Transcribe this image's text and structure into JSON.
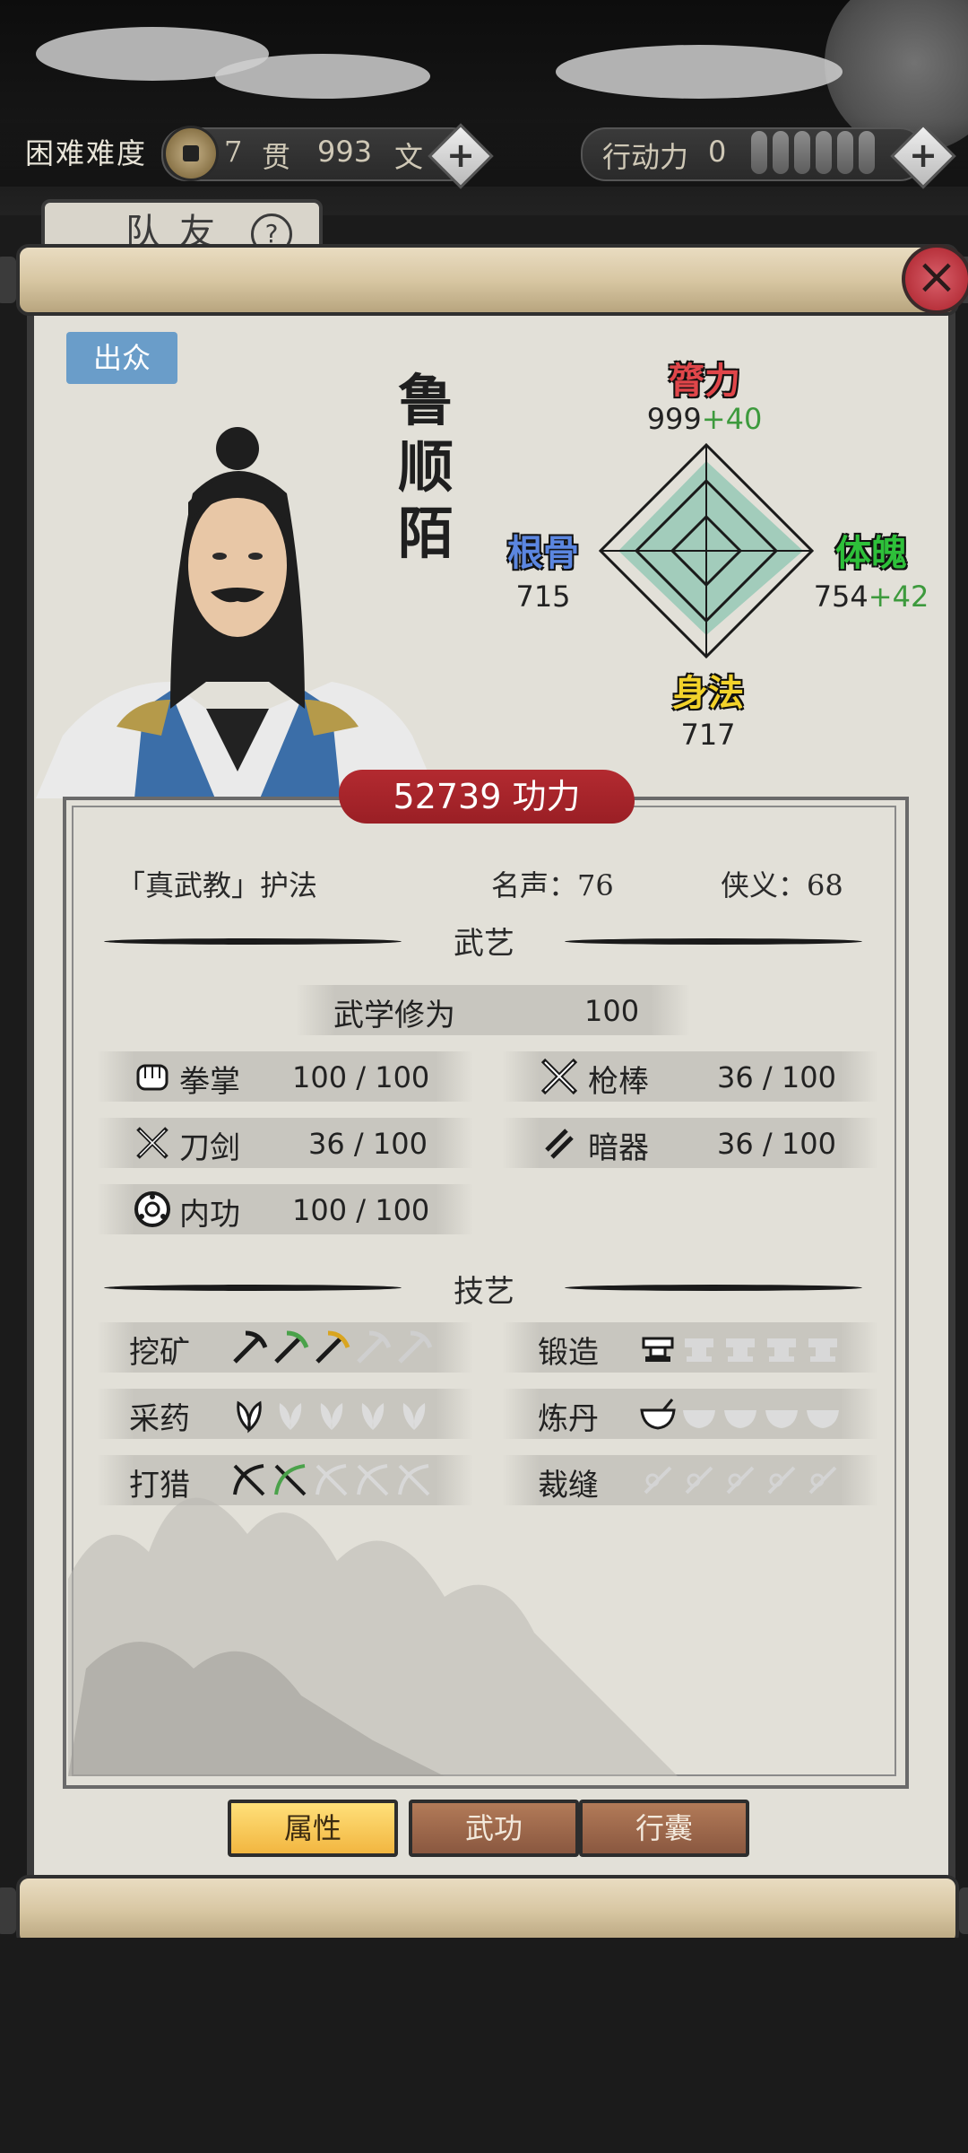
{
  "topbar": {
    "difficulty": "困难难度",
    "coin_amount": "7",
    "coin_unit_big": "贯",
    "coin_amount_small": "993",
    "coin_unit_small": "文",
    "action_label": "行动力",
    "action_value": "0",
    "action_pips": 6
  },
  "team_tab": {
    "label": "队友"
  },
  "character": {
    "badge": "出众",
    "name": "鲁顺陌",
    "stats": {
      "strength": {
        "label": "膂力",
        "value": "999",
        "bonus": "+40",
        "color": "#e0464a"
      },
      "constitution": {
        "label": "体魄",
        "value": "754",
        "bonus": "+42",
        "color": "#2ec03a"
      },
      "agility": {
        "label": "身法",
        "value": "717",
        "bonus": "",
        "color": "#f2d22a"
      },
      "bone": {
        "label": "根骨",
        "value": "715",
        "bonus": "",
        "color": "#5b86e0"
      }
    },
    "power": "52739 功力",
    "title": "「真武教」护法",
    "fame": "名声：76",
    "chivalry": "侠义：68"
  },
  "martial": {
    "section_title": "武艺",
    "cultivation_label": "武学修为",
    "cultivation_value": "100",
    "skills": [
      {
        "icon": "fist-icon",
        "name": "拳掌",
        "value": "100 / 100"
      },
      {
        "icon": "spear-icon",
        "name": "枪棒",
        "value": "36 / 100"
      },
      {
        "icon": "swords-icon",
        "name": "刀剑",
        "value": "36 / 100"
      },
      {
        "icon": "darts-icon",
        "name": "暗器",
        "value": "36 / 100"
      },
      {
        "icon": "inner-power-icon",
        "name": "内功",
        "value": "100 / 100"
      }
    ]
  },
  "crafts": {
    "section_title": "技艺",
    "items": [
      {
        "name": "挖矿",
        "icon": "pickaxe-icon",
        "level": 3,
        "max": 5
      },
      {
        "name": "锻造",
        "icon": "anvil-icon",
        "level": 1,
        "max": 5
      },
      {
        "name": "采药",
        "icon": "herb-icon",
        "level": 1,
        "max": 5
      },
      {
        "name": "炼丹",
        "icon": "bowl-icon",
        "level": 1,
        "max": 5
      },
      {
        "name": "打猎",
        "icon": "bow-icon",
        "level": 2,
        "max": 5
      },
      {
        "name": "裁缝",
        "icon": "needle-icon",
        "level": 0,
        "max": 5
      }
    ]
  },
  "buttons": {
    "attributes": "属性",
    "martial_arts": "武功",
    "bag": "行囊"
  }
}
